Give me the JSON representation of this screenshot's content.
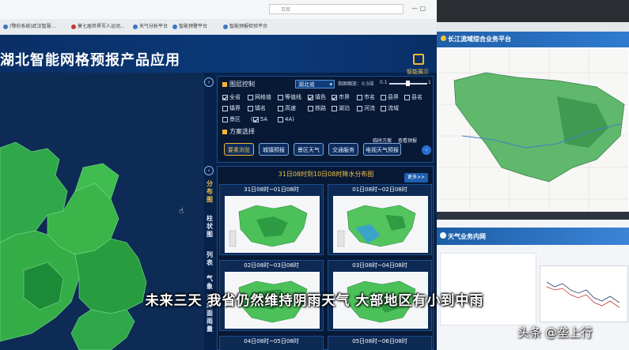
{
  "browser": {
    "tabs": [
      {
        "label": "(鄂份系统)武汉智慧..."
      },
      {
        "label": "莫七届世界军人运动..."
      },
      {
        "label": "天气分析平台"
      },
      {
        "label": "智能预警平台"
      },
      {
        "label": "智能预报检验平台"
      }
    ],
    "address_placeholder": "百度"
  },
  "app": {
    "title": "湖北智能网格预报产品应用",
    "smart_display_label": "智能展示"
  },
  "layer_panel": {
    "title": "图层控制",
    "province_select": "湖北省",
    "step_label": "指图缩放：0.5倍",
    "step_min": "0.1",
    "step_max": "1",
    "checkboxes_row1": [
      {
        "label": "全省",
        "checked": true
      },
      {
        "label": "网格值",
        "checked": false
      },
      {
        "label": "等值线",
        "checked": false
      },
      {
        "label": "填色",
        "checked": true
      },
      {
        "label": "市界",
        "checked": true
      },
      {
        "label": "市名",
        "checked": false
      },
      {
        "label": "县界",
        "checked": false
      },
      {
        "label": "县名",
        "checked": false
      }
    ],
    "checkboxes_row2": [
      {
        "label": "镇界",
        "checked": false
      },
      {
        "label": "镇名",
        "checked": false
      },
      {
        "label": "高速",
        "checked": false
      },
      {
        "label": "铁路",
        "checked": false
      },
      {
        "label": "湖泊",
        "checked": false
      },
      {
        "label": "河流",
        "checked": false
      },
      {
        "label": "流域",
        "checked": false
      }
    ],
    "checkboxes_row3": [
      {
        "label": "景区",
        "checked": false
      },
      {
        "label": "5A",
        "checked": true
      },
      {
        "label": "4A",
        "checked": false
      }
    ]
  },
  "scheme_panel": {
    "title": "方案选择",
    "links": [
      "临时方案",
      "查看预报"
    ],
    "buttons": [
      {
        "label": "要素浏览",
        "active": true
      },
      {
        "label": "城镇预报",
        "active": false
      },
      {
        "label": "景区天气",
        "active": false
      },
      {
        "label": "交通服务",
        "active": false
      },
      {
        "label": "电视天气预报",
        "active": false
      }
    ]
  },
  "distribution_panel": {
    "title": "31日08时到10日08时降水分布图",
    "more_label": "更多>>",
    "side_tabs": [
      "分布图",
      "柱状图",
      "列表",
      "气象",
      "湖库面雨量"
    ],
    "cards": [
      {
        "label": "31日08时~01日08时"
      },
      {
        "label": "01日08时~02日08时"
      },
      {
        "label": "02日08时~03日08时"
      },
      {
        "label": "03日08时~04日08时"
      },
      {
        "label": "04日08时~05日08时"
      },
      {
        "label": "05日08时~06日08时"
      }
    ]
  },
  "right_screen": {
    "top_title": "长江流域综合业务平台",
    "bottom_title": "天气业务内网"
  },
  "subtitle": "未来三天  我省仍然维持阴雨天气  大部地区有小到中雨",
  "watermark": "头条 @垄上行",
  "colors": {
    "app_bg": "#06224a",
    "accent": "#f2b632",
    "map_green": "#3bb54a"
  }
}
